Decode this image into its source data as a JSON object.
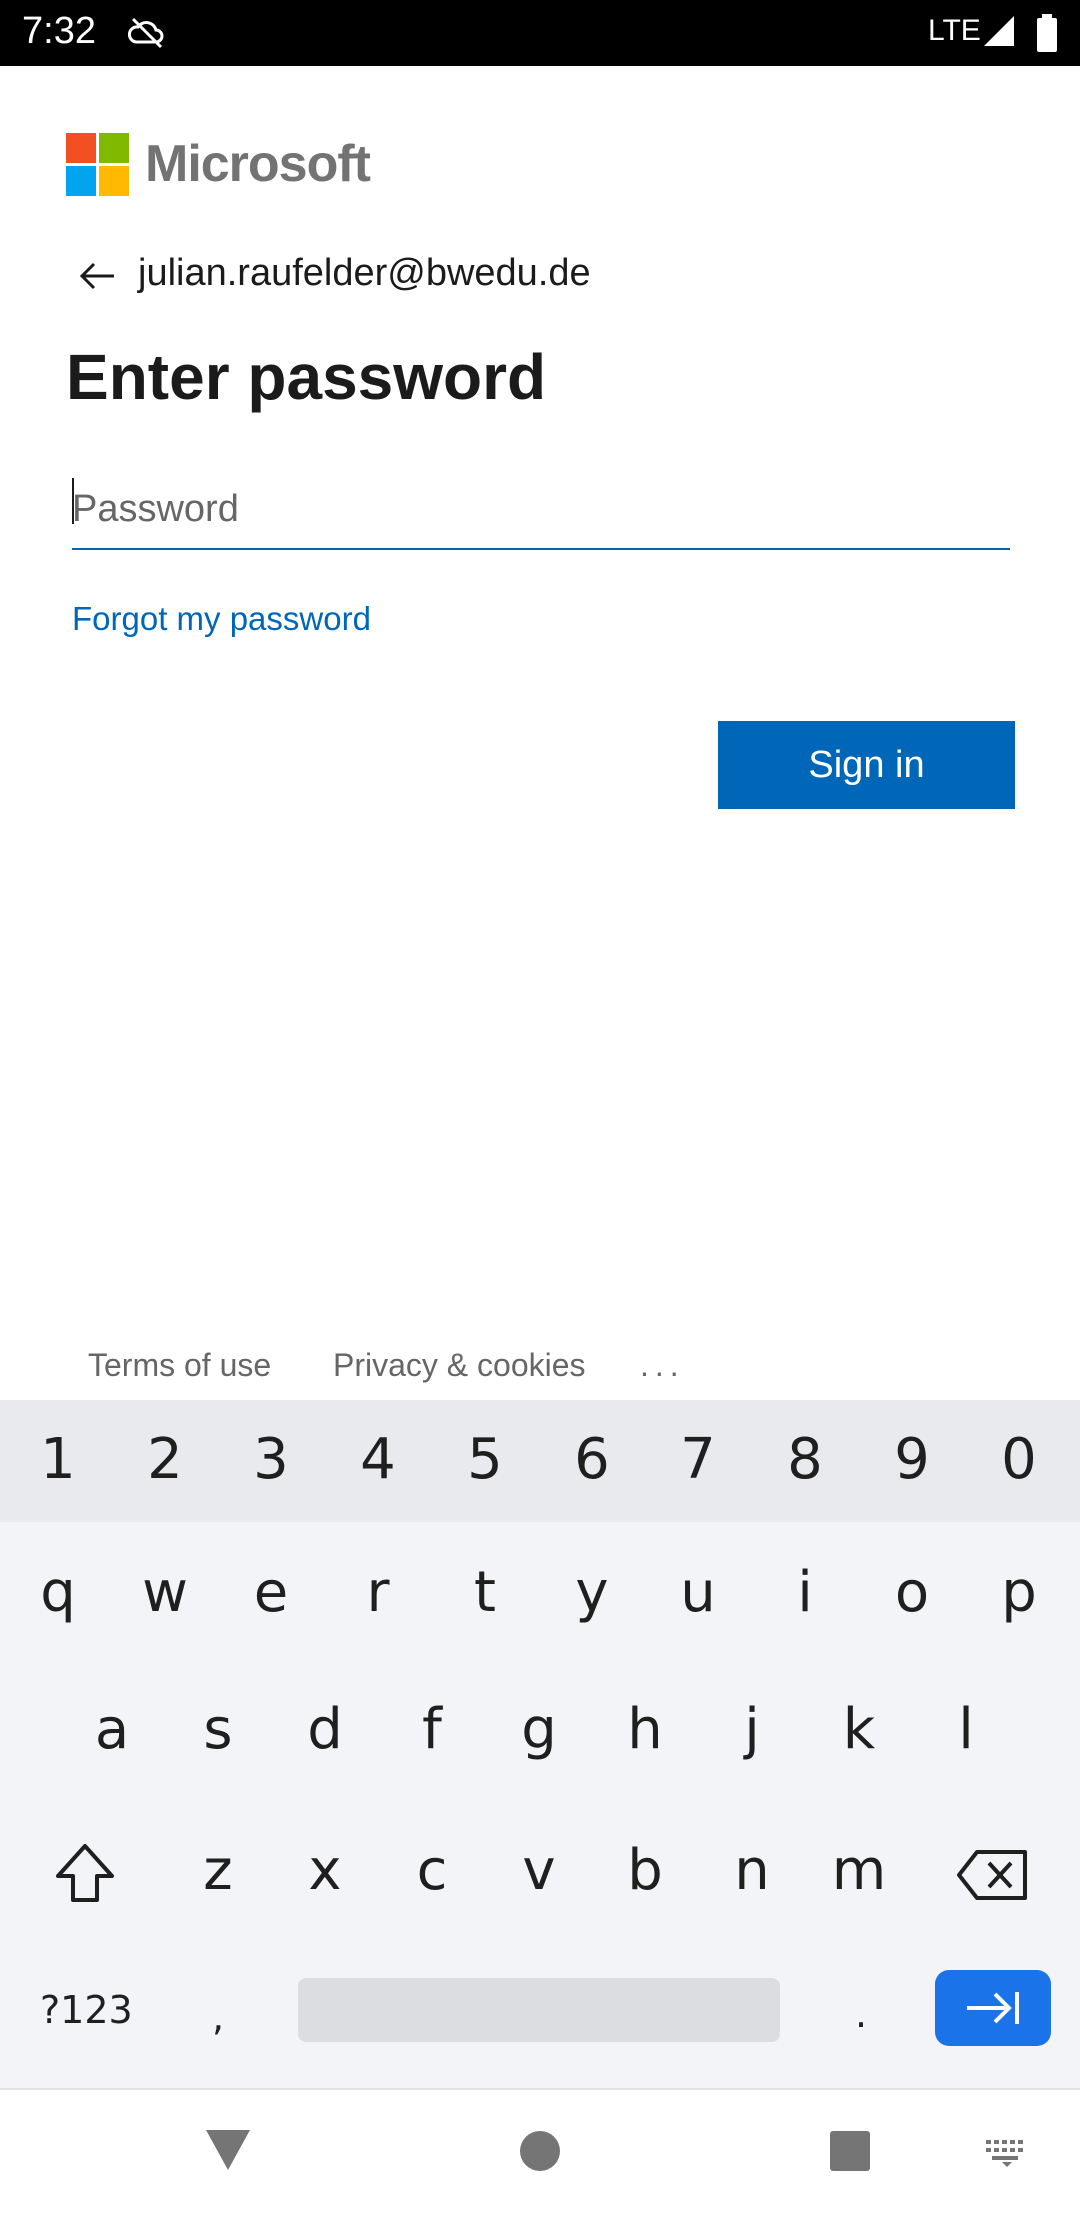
{
  "status_bar": {
    "time": "7:32",
    "network": "LTE"
  },
  "brand": {
    "name": "Microsoft"
  },
  "account": {
    "email": "julian.raufelder@bwedu.de"
  },
  "page": {
    "title": "Enter password",
    "password_placeholder": "Password",
    "password_value": "",
    "forgot_link": "Forgot my password",
    "signin_label": "Sign in"
  },
  "footer": {
    "terms": "Terms of use",
    "privacy": "Privacy & cookies",
    "more": "..."
  },
  "keyboard": {
    "numbers": [
      "1",
      "2",
      "3",
      "4",
      "5",
      "6",
      "7",
      "8",
      "9",
      "0"
    ],
    "row1": [
      "q",
      "w",
      "e",
      "r",
      "t",
      "y",
      "u",
      "i",
      "o",
      "p"
    ],
    "row2": [
      "a",
      "s",
      "d",
      "f",
      "g",
      "h",
      "j",
      "k",
      "l"
    ],
    "row3": [
      "z",
      "x",
      "c",
      "v",
      "b",
      "n",
      "m"
    ],
    "symbols_label": "?123",
    "comma": ",",
    "period": "."
  },
  "colors": {
    "accent": "#0067b8",
    "ms_red": "#f25022",
    "ms_green": "#7fba00",
    "ms_blue": "#00a4ef",
    "ms_yellow": "#ffb900"
  }
}
